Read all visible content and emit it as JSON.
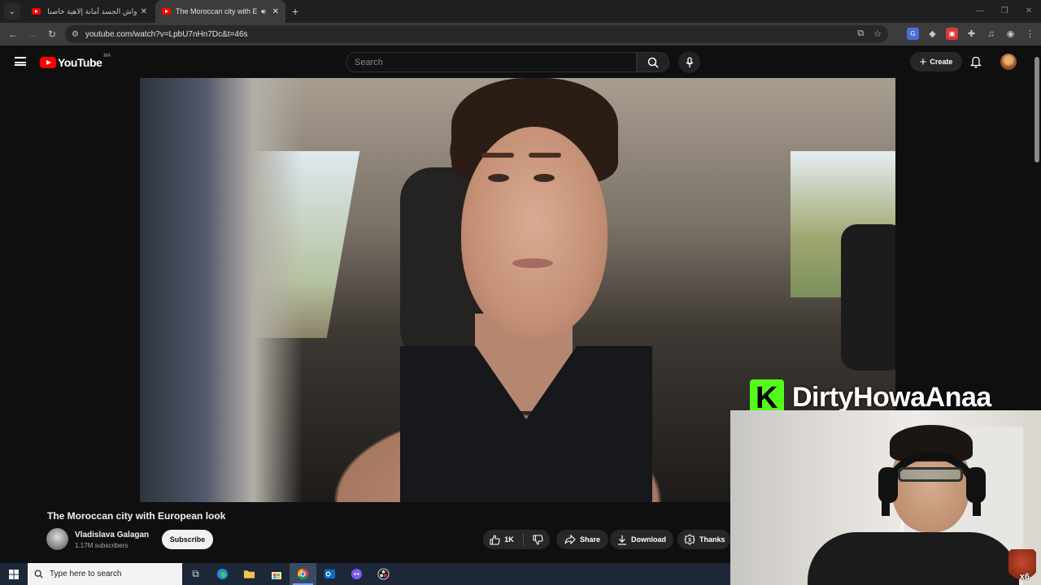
{
  "browser": {
    "tabs": [
      {
        "title": "واش الجسد أمانة إلاهية خاصنا نحافظو",
        "active": false
      },
      {
        "title": "The Moroccan city with European look",
        "active": true
      }
    ],
    "url": "youtube.com/watch?v=LpbU7nHn7Dc&t=46s"
  },
  "youtube": {
    "logo_text": "YouTube",
    "country_code": "MA",
    "search_placeholder": "Search",
    "create_label": "Create"
  },
  "video": {
    "title": "The Moroccan city with European look",
    "channel_name": "Vladislava Galagan",
    "subscribers": "1.17M subscribers",
    "subscribe_label": "Subscribe",
    "likes": "1K",
    "share_label": "Share",
    "download_label": "Download",
    "thanks_label": "Thanks"
  },
  "overlay": {
    "streamer_name": "DirtyHowaAnaa",
    "badge_text": "x6"
  },
  "taskbar": {
    "search_placeholder": "Type here to search"
  },
  "colors": {
    "yt_red": "#ff0000",
    "kick_green": "#53fc18",
    "background": "#0f0f0f"
  },
  "icons": [
    "search-icon",
    "mic-icon",
    "bell-icon",
    "like-icon",
    "dislike-icon",
    "share-icon",
    "download-icon",
    "thanks-icon",
    "windows-start-icon"
  ]
}
